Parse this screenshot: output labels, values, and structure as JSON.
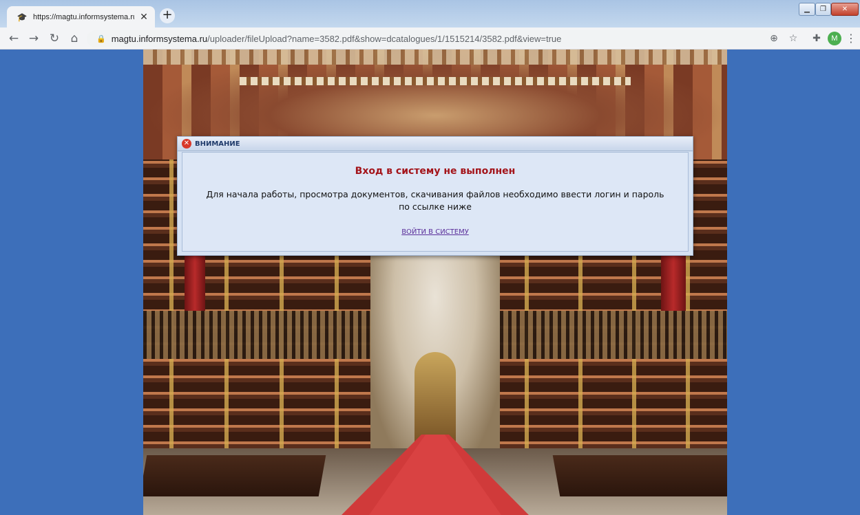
{
  "browser": {
    "tab": {
      "title": "https://magtu.informsystema.ru/",
      "favicon": "informsystema-logo-icon"
    },
    "url_host": "magtu.informsystema.ru",
    "url_path": "/uploader/fileUpload?name=3582.pdf&show=dcatalogues/1/1515214/3582.pdf&view=true",
    "profile_initial": "M",
    "icons": [
      "back-icon",
      "forward-icon",
      "reload-icon",
      "home-icon",
      "lock-icon",
      "zoom-icon",
      "star-icon",
      "extensions-icon",
      "menu-icon"
    ]
  },
  "dialog": {
    "title": "ВНИМАНИЕ",
    "heading": "Вход в систему не выполнен",
    "message": "Для начала работы, просмотра документов, скачивания файлов необходимо ввести логин и пароль по ссылке ниже",
    "link": "ВОЙТИ В СИСТЕМУ"
  },
  "colors": {
    "page_background": "#3d6fba",
    "dialog_heading": "#a3141a",
    "link": "#5a2e9a"
  }
}
